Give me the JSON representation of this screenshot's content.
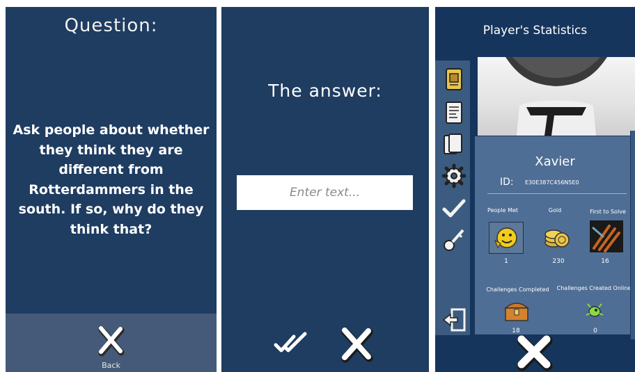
{
  "panel_question": {
    "title": "Question:",
    "text": "Ask people about whether they think they are different from Rotterdammers in the south. If so, why do they think that?",
    "back_label": "Back"
  },
  "panel_answer": {
    "title": "The answer:",
    "input_placeholder": "Enter text..."
  },
  "panel_stats": {
    "title": "Player's Statistics",
    "player_name": "Xavier",
    "id_label": "ID:",
    "id_value": "E30E387C456N5E0",
    "stats": {
      "people_met_label": "People Met",
      "people_met_value": "1",
      "gold_label": "Gold",
      "gold_value": "230",
      "first_to_solve_label": "First to Solve",
      "first_to_solve_value": "16",
      "challenges_completed_label": "Challenges Completed",
      "challenges_completed_value": "18",
      "challenges_created_label": "Challenges Created Online",
      "challenges_created_value": "0"
    },
    "sidebar_icons": [
      "id-card-icon",
      "document-icon",
      "cards-icon",
      "settings-gear-icon",
      "checkmark-icon",
      "key-icon",
      "exit-door-icon"
    ]
  },
  "colors": {
    "panel_bg": "#1f3c61",
    "footer_bg": "#445a78",
    "stats_bg": "#4f6e95",
    "sidebar_bg": "#3c5b80"
  }
}
